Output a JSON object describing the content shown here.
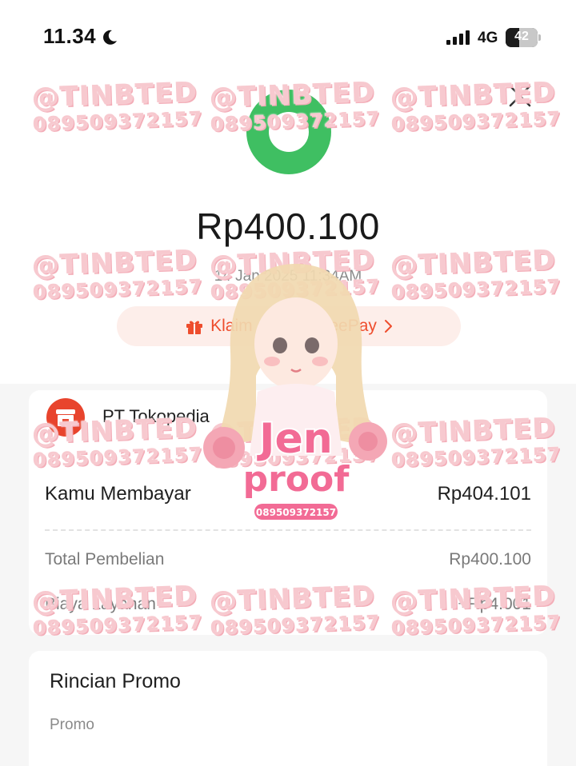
{
  "status_bar": {
    "time": "11.34",
    "network": "4G",
    "battery": "42",
    "battery_level_percent": 42,
    "icons": [
      "moon-icon",
      "signal-icon"
    ]
  },
  "receipt": {
    "amount": "Rp400.100",
    "datetime": "14 Jan 2025 11:34AM",
    "reward_banner": "Klaim dari ShopeePay",
    "reward_icon": "gift-icon",
    "success_color": "#3fbf62",
    "accent_color": "#ee4d2d"
  },
  "merchant": {
    "name": "PT Tokopedia",
    "logo_icon": "store-icon",
    "pay_label": "Kamu Membayar",
    "pay_value": "Rp404.101",
    "rows": [
      {
        "label": "Total Pembelian",
        "value": "Rp400.100"
      },
      {
        "label": "Biaya Layanan",
        "value": "+Rp4.001"
      }
    ]
  },
  "promo": {
    "title": "Rincian Promo",
    "label": "Promo"
  },
  "watermark": {
    "handle": "@TINBTED",
    "phone": "089509372157",
    "stamp_line1": "Jen",
    "stamp_line2": "proof",
    "stamp_phone": "089509372157"
  }
}
